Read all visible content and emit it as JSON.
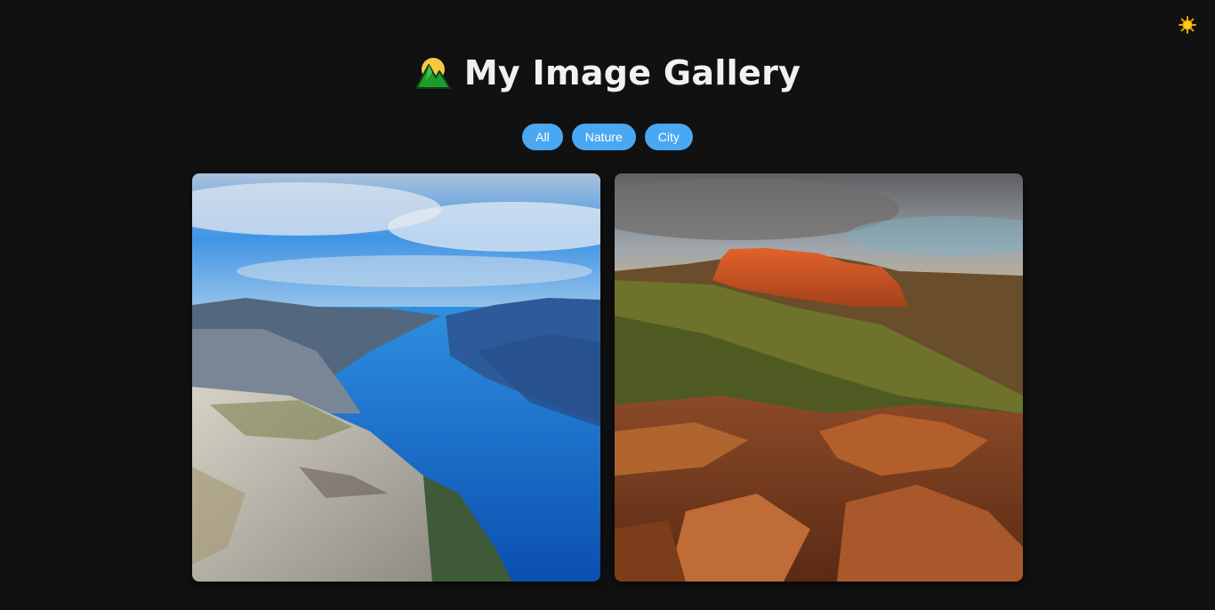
{
  "header": {
    "logo_icon": "sunrise-over-mountains-icon",
    "title": "My Image Gallery"
  },
  "theme_toggle": {
    "icon": "sun-icon"
  },
  "filters": [
    {
      "label": "All"
    },
    {
      "label": "Nature"
    },
    {
      "label": "City"
    }
  ],
  "colors": {
    "background": "#111111",
    "accent": "#4aa8f2",
    "title": "#f1f1f1"
  },
  "gallery": {
    "images": [
      {
        "category": "Nature",
        "depicts": "fjord-cliff"
      },
      {
        "category": "Nature",
        "depicts": "red-rock-canyon"
      }
    ]
  }
}
